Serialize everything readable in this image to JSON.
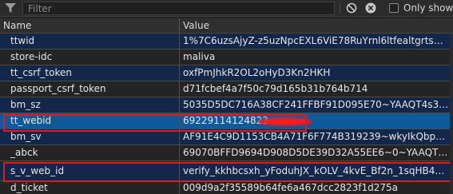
{
  "toolbar": {
    "filter_placeholder": "Filter",
    "only_show_label": "Only show c",
    "filter_icon": "funnel-icon",
    "block_icon": "block-icon",
    "clear_icon": "clear-icon"
  },
  "table": {
    "columns": [
      "Name",
      "Value"
    ],
    "rows": [
      {
        "name": "ttwid",
        "value": "1%7C6uzsAjyZ-z5uzNpcEXL6ViE78RuYrnl6ltfealtgrts%7C…"
      },
      {
        "name": "store-idc",
        "value": "maliva"
      },
      {
        "name": "tt_csrf_token",
        "value": "oxfPmJhkR2OL2oHyD3Kn2HKH"
      },
      {
        "name": "passport_csrf_token",
        "value": "d71fcbef4a7f50c79d165b31b764b714"
      },
      {
        "name": "bm_sz",
        "value": "5035D5DC716A38CF241FFBF91D095E70~YAAQT4s31UA…"
      },
      {
        "name": "tt_webid",
        "value": "69229114124823"
      },
      {
        "name": "bm_sv",
        "value": "AF91E4C9D1153CB4A71F6F774B319239~wkyIkQbpgl+M…"
      },
      {
        "name": "_abck",
        "value": "69070BFFD9694D908D5DE39D32A55EE6~0~YAAQT4s31…"
      },
      {
        "name": "s_v_web_id",
        "value": "verify_kkhbcsxh_yFoduhJX_kOLV_4kvE_Bf2n_1sqHB4XoS…"
      },
      {
        "name": "d_ticket",
        "value": "009d9a2f35589b64fe6a467dcc2823f1d275a"
      }
    ]
  },
  "colors": {
    "selected_row": "#0f5a9b",
    "odd_row": "#12274a",
    "highlight_box": "#e0191e"
  }
}
